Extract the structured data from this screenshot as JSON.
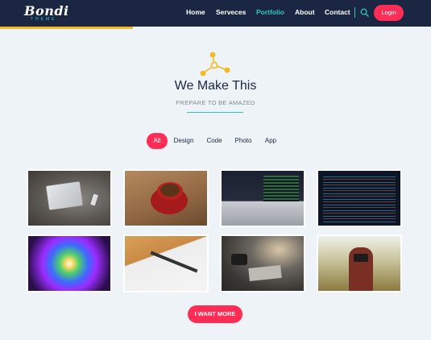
{
  "brand": {
    "name": "Bondi",
    "tagline": "THEME"
  },
  "nav": {
    "items": [
      {
        "label": "Home"
      },
      {
        "label": "Serveces"
      },
      {
        "label": "Portfolio",
        "active": true
      },
      {
        "label": "About"
      },
      {
        "label": "Contact"
      }
    ],
    "search_icon": "search-icon",
    "login_label": "Login"
  },
  "section": {
    "icon": "share-nodes-icon",
    "title": "We Make This",
    "subtitle": "PREPARE TO BE AMAZED"
  },
  "filters": [
    {
      "label": "All",
      "active": true
    },
    {
      "label": "Design"
    },
    {
      "label": "Code"
    },
    {
      "label": "Photo"
    },
    {
      "label": "App"
    }
  ],
  "gallery": {
    "items": [
      {
        "subject": "laptop-and-phone-photo"
      },
      {
        "subject": "coffee-cup-photo"
      },
      {
        "subject": "laptop-code-photo"
      },
      {
        "subject": "code-screen-photo"
      },
      {
        "subject": "colorful-lights-photo"
      },
      {
        "subject": "pen-and-sketch-photo"
      },
      {
        "subject": "camera-and-photos-photo"
      },
      {
        "subject": "photographer-photo"
      }
    ]
  },
  "more_button": "I WANT MORE",
  "colors": {
    "header_bg": "#1b2742",
    "accent_teal": "#2ec9c0",
    "accent_pink": "#ff2d55",
    "accent_yellow": "#f4b823",
    "page_bg": "#eef3f7"
  }
}
